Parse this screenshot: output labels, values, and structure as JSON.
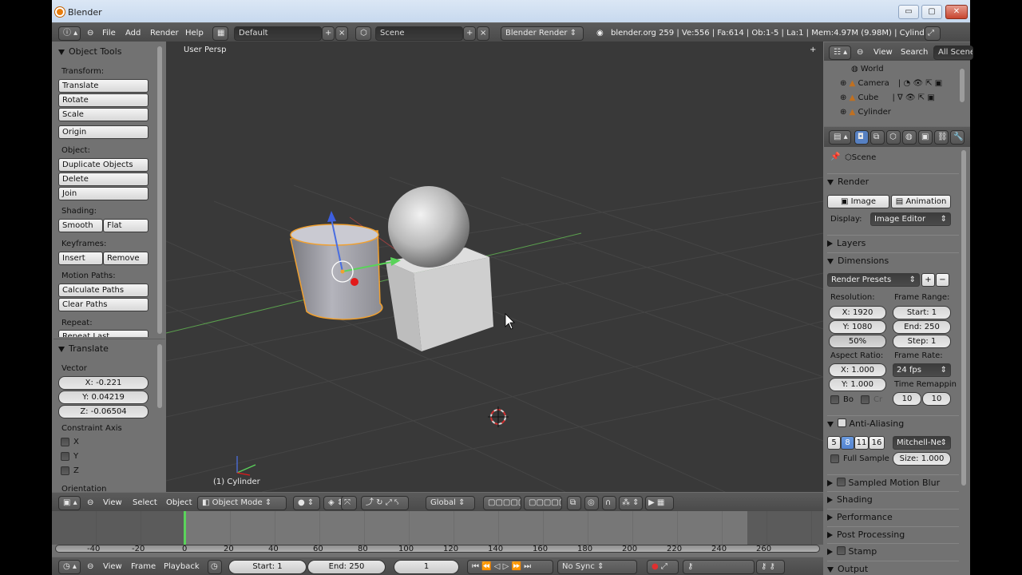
{
  "window": {
    "title": "Blender",
    "minimize": "▭",
    "maximize": "▢",
    "close": "✕"
  },
  "info_header": {
    "menus": [
      "File",
      "Add",
      "Render",
      "Help"
    ],
    "screen_layout": "Default",
    "scene": "Scene",
    "render_engine": "Blender Render",
    "stats": "blender.org 259 | Ve:556 | Fa:614 | Ob:1-5 | La:1 | Mem:4.97M (9.98M) | Cylinder"
  },
  "tool_shelf": {
    "title": "Object Tools",
    "transform_label": "Transform:",
    "transform_buttons": [
      "Translate",
      "Rotate",
      "Scale"
    ],
    "origin_button": "Origin",
    "object_label": "Object:",
    "object_buttons": [
      "Duplicate Objects",
      "Delete",
      "Join"
    ],
    "shading_label": "Shading:",
    "shading_smooth": "Smooth",
    "shading_flat": "Flat",
    "keyframes_label": "Keyframes:",
    "keyframe_insert": "Insert",
    "keyframe_remove": "Remove",
    "motion_paths_label": "Motion Paths:",
    "motion_paths_buttons": [
      "Calculate Paths",
      "Clear Paths"
    ],
    "repeat_label": "Repeat:",
    "repeat_last": "Repeat Last"
  },
  "operator_panel": {
    "title": "Translate",
    "vector_label": "Vector",
    "x": "X: -0.221",
    "y": "Y: 0.04219",
    "z": "Z: -0.06504",
    "constraint_label": "Constraint Axis",
    "axes": [
      "X",
      "Y",
      "Z"
    ],
    "orientation_label": "Orientation"
  },
  "viewport": {
    "view_name": "User Persp",
    "selected_object": "(1) Cylinder"
  },
  "view3d_header": {
    "menus": [
      "View",
      "Select",
      "Object"
    ],
    "mode": "Object Mode",
    "orientation": "Global"
  },
  "outliner": {
    "menus": [
      "View",
      "Search"
    ],
    "filter": "All Scenes",
    "items": [
      "World",
      "Camera",
      "Cube",
      "Cylinder"
    ]
  },
  "properties": {
    "context": "Scene",
    "render_section": "Render",
    "image_button": "Image",
    "animation_button": "Animation",
    "display_label": "Display:",
    "display_value": "Image Editor",
    "layers_section": "Layers",
    "dimensions_section": "Dimensions",
    "render_presets": "Render Presets",
    "resolution_label": "Resolution:",
    "res_x": "X: 1920",
    "res_y": "Y: 1080",
    "res_pct": "50%",
    "frame_range_label": "Frame Range:",
    "start": "Start: 1",
    "end": "End: 250",
    "step": "Step: 1",
    "aspect_label": "Aspect Ratio:",
    "aspect_x": "X: 1.000",
    "aspect_y": "Y: 1.000",
    "frame_rate_label": "Frame Rate:",
    "fps": "24 fps",
    "time_remap_label": "Time Remappin",
    "remap_old": "10",
    "remap_new": "10",
    "border_label": "Bo",
    "crop_label": "Cr",
    "aa_section": "Anti-Aliasing",
    "aa_samples": [
      "5",
      "8",
      "11",
      "16"
    ],
    "aa_selected_sample": "8",
    "aa_filter": "Mitchell-Ne",
    "full_sample": "Full Sample",
    "filter_size": "Size: 1.000",
    "collapsed_sections": [
      "Sampled Motion Blur",
      "Shading",
      "Performance",
      "Post Processing",
      "Stamp",
      "Output"
    ]
  },
  "timeline": {
    "ticks": [
      "-40",
      "-20",
      "0",
      "20",
      "40",
      "60",
      "80",
      "100",
      "120",
      "140",
      "160",
      "180",
      "200",
      "220",
      "240",
      "260"
    ],
    "current_frame_marker": 0,
    "menus": [
      "View",
      "Frame",
      "Playback"
    ],
    "start": "Start: 1",
    "end": "End: 250",
    "current": "1",
    "sync": "No Sync"
  },
  "colors": {
    "ui_gray": "#727272",
    "viewport_bg": "#393939",
    "selection_orange": "#f0a030",
    "current_frame_green": "#5bd35b",
    "blender_orange": "#e87d0d",
    "active_blue": "#5680c2"
  }
}
